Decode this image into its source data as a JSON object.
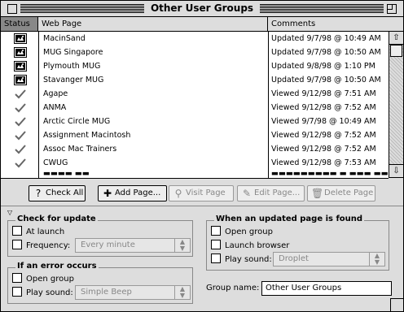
{
  "window": {
    "title": "Other User Groups"
  },
  "columns": {
    "status": "Status",
    "web_page": "Web Page",
    "comments": "Comments"
  },
  "rows": [
    {
      "status": "updated",
      "name": "MacinSand",
      "comment": "Updated 9/7/98 @ 10:49 AM"
    },
    {
      "status": "updated",
      "name": "MUG Singapore",
      "comment": "Updated 9/7/98 @ 10:50 AM"
    },
    {
      "status": "updated",
      "name": "Plymouth MUG",
      "comment": "Updated 9/8/98 @ 1:10 PM"
    },
    {
      "status": "updated",
      "name": "Stavanger MUG",
      "comment": "Updated 9/7/98 @ 10:50 AM"
    },
    {
      "status": "viewed",
      "name": "Agape",
      "comment": "Viewed 9/12/98 @ 7:51 AM"
    },
    {
      "status": "viewed",
      "name": "ANMA",
      "comment": "Viewed 9/12/98 @ 7:52 AM"
    },
    {
      "status": "viewed",
      "name": "Arctic Circle MUG",
      "comment": "Viewed 9/7/98 @ 10:49 AM"
    },
    {
      "status": "viewed",
      "name": "Assignment Macintosh",
      "comment": "Viewed 9/12/98 @ 7:52 AM"
    },
    {
      "status": "viewed",
      "name": "Assoc Mac Trainers",
      "comment": "Viewed 9/12/98 @ 7:52 AM"
    },
    {
      "status": "viewed",
      "name": "CWUG",
      "comment": "Viewed 9/12/98 @ 7:53 AM"
    }
  ],
  "toolbar": {
    "check_all": "Check All",
    "add_page": "Add Page...",
    "visit_page": "Visit Page",
    "edit_page": "Edit Page...",
    "delete_page": "Delete Page"
  },
  "check_for_update": {
    "label": "Check for update",
    "at_launch": "At launch",
    "frequency": "Frequency:",
    "frequency_value": "Every minute"
  },
  "if_error": {
    "label": "If an error occurs",
    "open_group": "Open group",
    "play_sound": "Play sound:",
    "sound_value": "Simple Beep"
  },
  "when_updated": {
    "label": "When an updated page is found",
    "open_group": "Open group",
    "launch_browser": "Launch browser",
    "play_sound": "Play sound:",
    "sound_value": "Droplet"
  },
  "group_name": {
    "label": "Group name:",
    "value": "Other User Groups"
  }
}
